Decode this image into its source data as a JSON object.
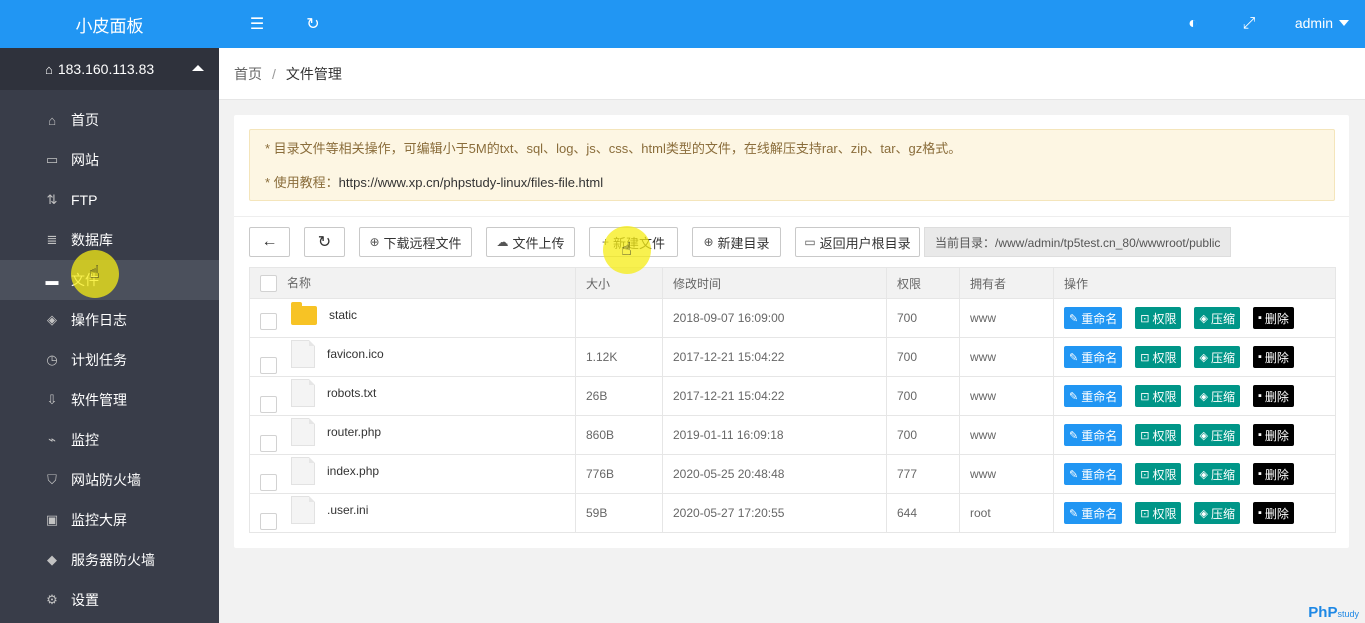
{
  "sidebar": {
    "brand": "小皮面板",
    "server_ip": "183.160.113.83",
    "items": [
      {
        "label": "首页",
        "icon": "home-icon",
        "glyph": "⌂"
      },
      {
        "label": "网站",
        "icon": "monitor-icon",
        "glyph": "▭"
      },
      {
        "label": "FTP",
        "icon": "ftp-icon",
        "glyph": "⇅"
      },
      {
        "label": "数据库",
        "icon": "database-icon",
        "glyph": "≣"
      },
      {
        "label": "文件",
        "icon": "folder-icon",
        "glyph": "▬"
      },
      {
        "label": "操作日志",
        "icon": "layers-icon",
        "glyph": "◈"
      },
      {
        "label": "计划任务",
        "icon": "clock-icon",
        "glyph": "◷"
      },
      {
        "label": "软件管理",
        "icon": "download-icon",
        "glyph": "⇩"
      },
      {
        "label": "监控",
        "icon": "chart-icon",
        "glyph": "⌁"
      },
      {
        "label": "网站防火墙",
        "icon": "shield-icon",
        "glyph": "⛉"
      },
      {
        "label": "监控大屏",
        "icon": "screen-icon",
        "glyph": "▣"
      },
      {
        "label": "服务器防火墙",
        "icon": "shield-solid-icon",
        "glyph": "◆"
      },
      {
        "label": "设置",
        "icon": "gear-icon",
        "glyph": "⚙"
      }
    ]
  },
  "header": {
    "user": "admin",
    "menu_glyph": "☰",
    "refresh_glyph": "↻",
    "theme_glyph": "◐",
    "fullscreen_glyph": "⤢"
  },
  "breadcrumb": {
    "home": "首页",
    "sep": "/",
    "current": "文件管理"
  },
  "notice": {
    "line1": "* 目录文件等相关操作，可编辑小于5M的txt、sql、log、js、css、html类型的文件，在线解压支持rar、zip、tar、gz格式。",
    "line2_prefix": "* 使用教程：",
    "line2_link": "https://www.xp.cn/phpstudy-linux/files-file.html"
  },
  "toolbar": {
    "back_glyph": "←",
    "refresh_glyph": "↻",
    "download_remote": "下载远程文件",
    "upload": "文件上传",
    "new_file": "新建文件",
    "new_dir": "新建目录",
    "home_dir": "返回用户根目录",
    "current_dir": "当前目录：/www/admin/tp5test.cn_80/wwwroot/public",
    "download_glyph": "⊕",
    "upload_glyph": "☁",
    "plus_glyph": "+",
    "plus_circle_glyph": "⊕",
    "home_dir_glyph": "▭"
  },
  "table": {
    "headers": [
      "名称",
      "大小",
      "修改时间",
      "权限",
      "拥有者",
      "操作"
    ],
    "actions": {
      "rename": "重命名",
      "perm": "权限",
      "zip": "压缩",
      "delete": "删除",
      "rename_glyph": "✎",
      "perm_glyph": "⊡",
      "zip_glyph": "◈",
      "delete_glyph": "▪"
    },
    "rows": [
      {
        "name": "static",
        "type": "folder",
        "size": "",
        "mtime": "2018-09-07 16:09:00",
        "perm": "700",
        "owner": "www"
      },
      {
        "name": "favicon.ico",
        "type": "file",
        "size": "1.12K",
        "mtime": "2017-12-21 15:04:22",
        "perm": "700",
        "owner": "www"
      },
      {
        "name": "robots.txt",
        "type": "file",
        "size": "26B",
        "mtime": "2017-12-21 15:04:22",
        "perm": "700",
        "owner": "www"
      },
      {
        "name": "router.php",
        "type": "file",
        "size": "860B",
        "mtime": "2019-01-11 16:09:18",
        "perm": "700",
        "owner": "www"
      },
      {
        "name": "index.php",
        "type": "file",
        "size": "776B",
        "mtime": "2020-05-25 20:48:48",
        "perm": "777",
        "owner": "www"
      },
      {
        "name": ".user.ini",
        "type": "file",
        "size": "59B",
        "mtime": "2020-05-27 17:20:55",
        "perm": "644",
        "owner": "root"
      }
    ]
  },
  "watermark": {
    "main": "PhP",
    "sub": "study"
  },
  "colors": {
    "brand": "#2196f3",
    "sidebar": "#393d49",
    "green": "#009688",
    "highlight": "#f5ec14"
  }
}
